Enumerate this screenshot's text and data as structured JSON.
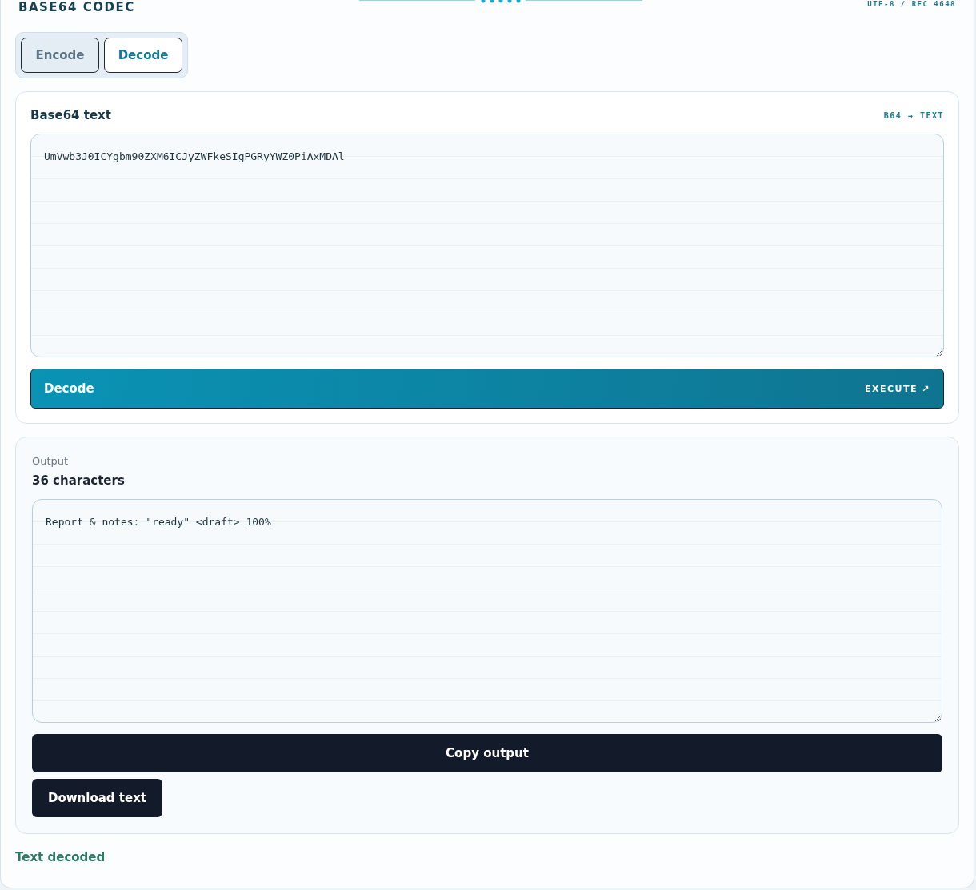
{
  "header": {
    "title": "BASE64 CODEC",
    "meta": "UTF-8 / RFC 4648"
  },
  "tabs": [
    {
      "label": "Encode",
      "selected": false
    },
    {
      "label": "Decode",
      "selected": true
    }
  ],
  "input_panel": {
    "title": "Base64 text",
    "tag": "B64 → TEXT",
    "value": "UmVwb3J0ICYgbm90ZXM6ICJyZWFkeSIgPGRyYWZ0PiAxMDAl",
    "action": {
      "label": "Decode",
      "hint": "EXECUTE ↗"
    }
  },
  "output_panel": {
    "label": "Output",
    "count": "36 characters",
    "value": "Report & notes: \"ready\" <draft> 100%",
    "buttons": [
      {
        "label": "Copy output",
        "kind": "wide"
      },
      {
        "label": "Download text",
        "kind": "compact"
      }
    ]
  },
  "status": "Text decoded"
}
